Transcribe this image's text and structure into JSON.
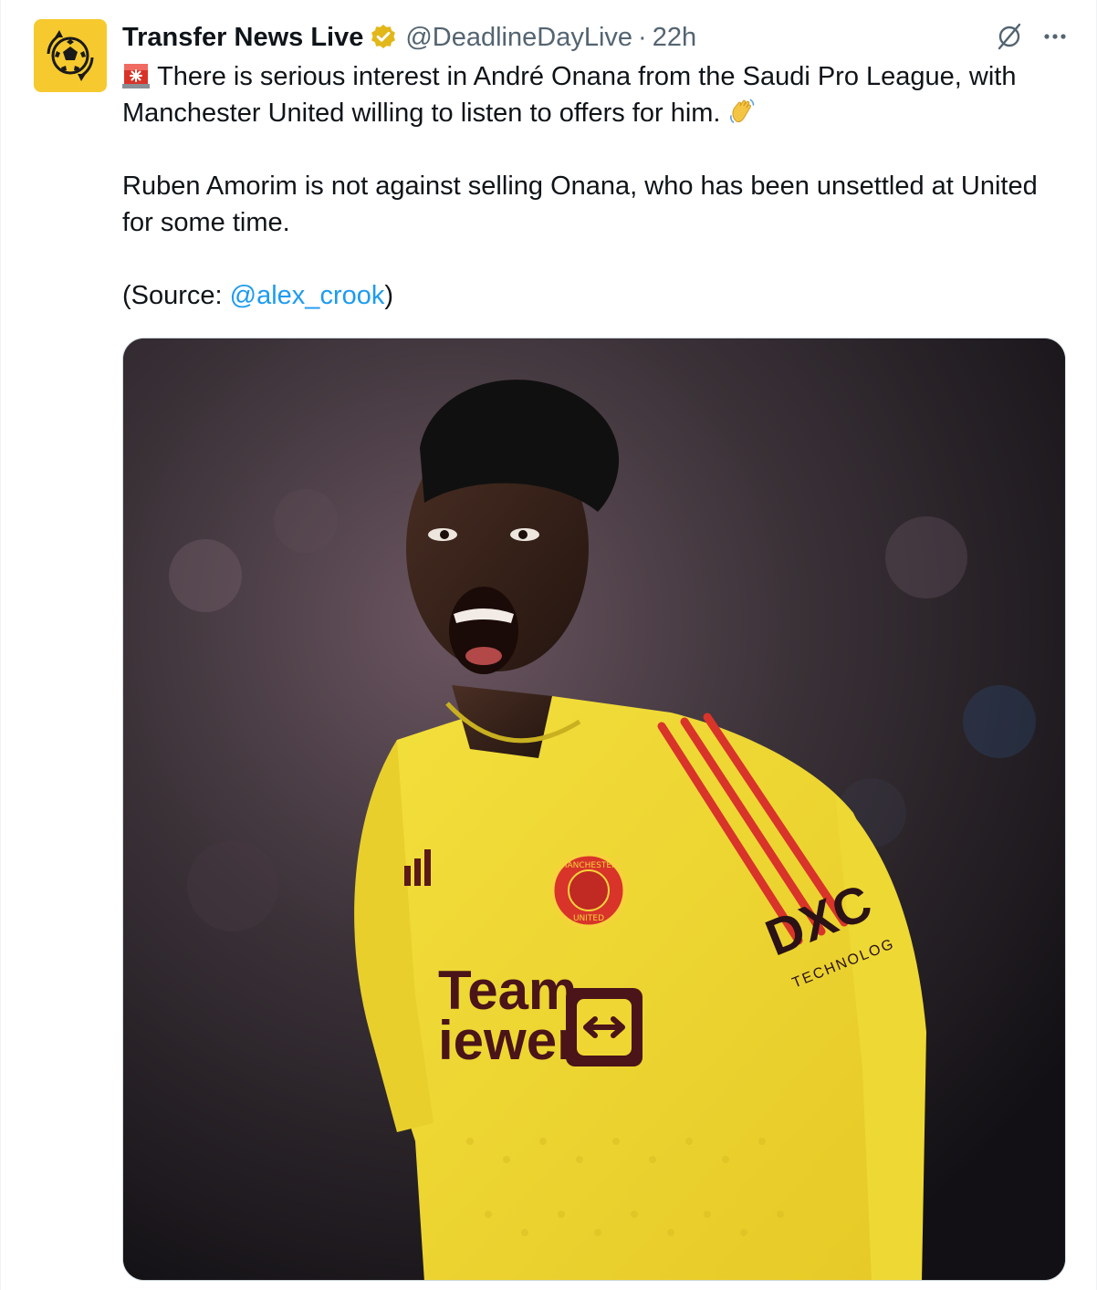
{
  "tweet": {
    "author": {
      "display_name": "Transfer News Live",
      "handle": "@DeadlineDayLive",
      "separator": "·",
      "time": "22h",
      "avatar_icon": "soccer-ball-logo",
      "verified_icon": "verified-badge-gold"
    },
    "text": {
      "para1_emoji": "police-light-emoji",
      "para1": "There is serious interest in André Onana from the Saudi Pro League, with Manchester United willing to listen to offers for him.",
      "para1_end_emoji": "waving-hand-emoji",
      "para2": "Ruben Amorim is not against selling Onana, who has been unsettled at United for some time.",
      "para3_prefix": "(Source: ",
      "para3_mention": "@alex_crook",
      "para3_suffix": ")"
    },
    "media": {
      "description": "photo",
      "shirt_sponsor_line1": "Team",
      "shirt_sponsor_line2": "iewer",
      "sleeve_sponsor": "DXC",
      "sleeve_sponsor_sub": "TECHNOLOG",
      "badge_top": "MANCHESTER",
      "badge_bottom": "UNITED"
    },
    "actions": {
      "grok_icon": "grok-slash-icon",
      "more_icon": "more-dots-icon"
    },
    "colors": {
      "accent": "#1d9bf0",
      "avatar_bg": "#f6c92e",
      "verified_gold": "#e2b719",
      "shirt_yellow": "#f0d632",
      "stripe_red": "#d8342a"
    }
  }
}
